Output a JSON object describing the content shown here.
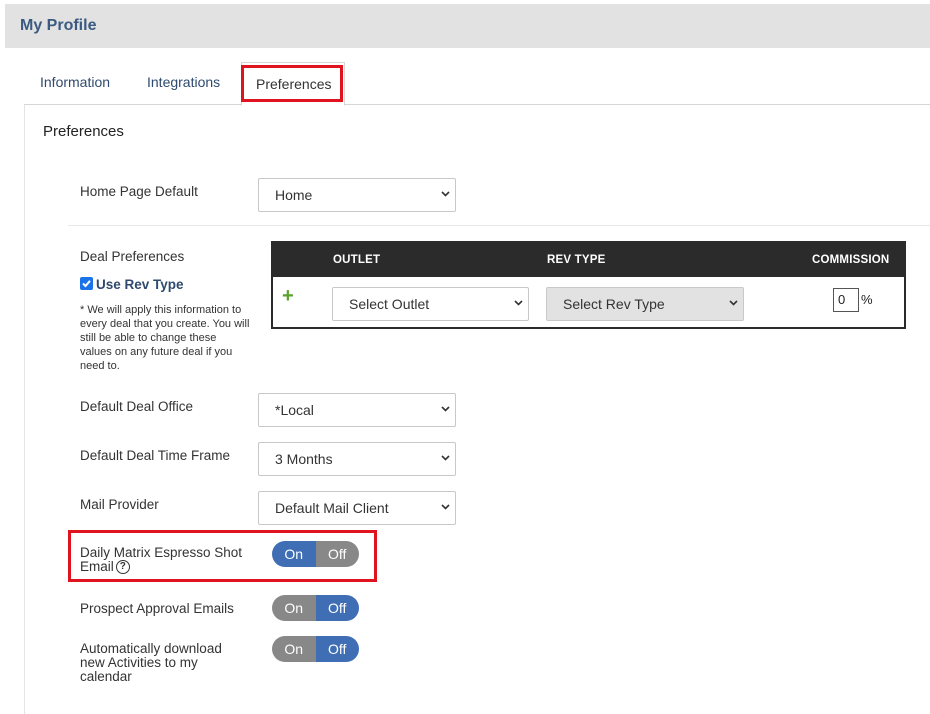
{
  "header": {
    "title": "My Profile"
  },
  "tabs": [
    {
      "label": "Information"
    },
    {
      "label": "Integrations"
    },
    {
      "label": "Preferences"
    }
  ],
  "section": {
    "title": "Preferences"
  },
  "home_page": {
    "label": "Home Page Default",
    "value": "Home"
  },
  "deal_prefs": {
    "label": "Deal Preferences",
    "use_rev_type_label": "Use Rev Type",
    "use_rev_type_checked": true,
    "note": "* We will apply this information to every deal that you create. You will still be able to change these values on any future deal if you need to.",
    "table": {
      "headers": [
        "OUTLET",
        "REV TYPE",
        "COMMISSION"
      ],
      "add_icon": "plus-icon",
      "outlet_placeholder": "Select Outlet",
      "rev_type_placeholder": "Select Rev Type",
      "commission_value": "0",
      "commission_unit": "%"
    }
  },
  "deal_office": {
    "label": "Default Deal Office",
    "value": "*Local"
  },
  "deal_time_frame": {
    "label": "Default Deal Time Frame",
    "value": "3 Months"
  },
  "mail_provider": {
    "label": "Mail Provider",
    "value": "Default Mail Client"
  },
  "toggles": [
    {
      "label": "Daily Matrix Espresso Shot Email",
      "help_icon": "question-circle-icon",
      "on_label": "On",
      "off_label": "Off",
      "state": "on"
    },
    {
      "label": "Prospect Approval Emails",
      "on_label": "On",
      "off_label": "Off",
      "state": "off"
    },
    {
      "label": "Automatically download new Activities to my calendar",
      "on_label": "On",
      "off_label": "Off",
      "state": "off"
    }
  ],
  "colors": {
    "accent": "#3f6eb5",
    "toggle_inactive": "#888888",
    "highlight": "#e0141e",
    "header_bg": "#e2e2e2",
    "table_header": "#2b2b2b",
    "plus_icon": "#5aa32a"
  }
}
